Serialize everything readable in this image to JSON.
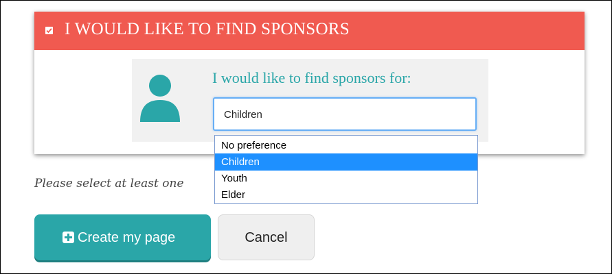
{
  "colors": {
    "header": "#f05a50",
    "accent": "#2aa6a8",
    "selection": "#1e90ff",
    "panel": "#f1f1f1",
    "focus_border": "#66aef5"
  },
  "header": {
    "title": "I WOULD LIKE TO FIND SPONSORS",
    "checkbox_checked": true,
    "checkbox_icon": "checkbox-checked-icon"
  },
  "sponsor_panel": {
    "avatar_icon": "user-avatar-icon",
    "prompt": "I would like to find sponsors for:",
    "select": {
      "value": "Children",
      "options": [
        "No preference",
        "Children",
        "Youth",
        "Elder"
      ],
      "highlighted_index": 1
    }
  },
  "helper_text": "Please select at least one",
  "buttons": {
    "create_label": "Create my page",
    "create_icon": "plus-square-icon",
    "cancel_label": "Cancel"
  }
}
